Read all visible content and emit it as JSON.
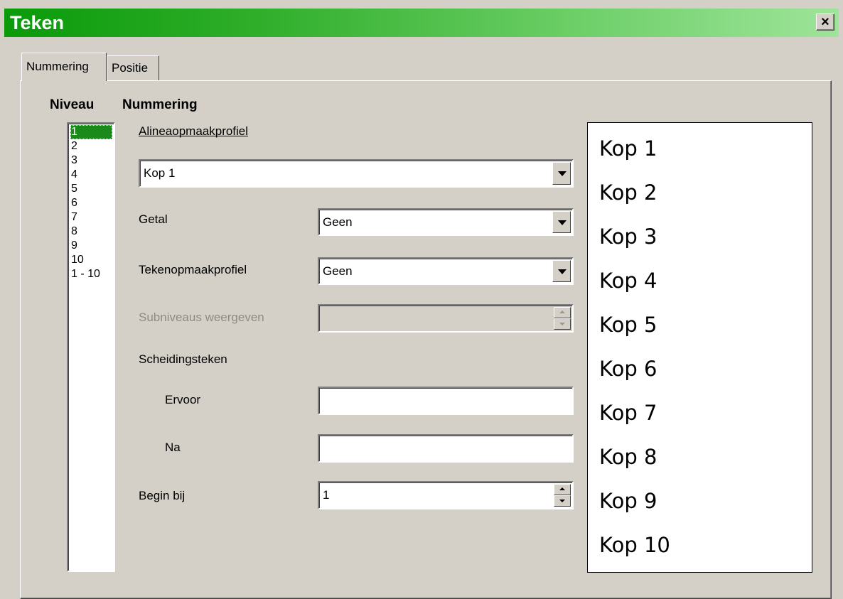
{
  "window": {
    "title": "Teken",
    "close_label": "×"
  },
  "tabs": [
    {
      "label": "Nummering",
      "active": true
    },
    {
      "label": "Positie",
      "active": false
    }
  ],
  "headings": {
    "level": "Niveau",
    "numbering": "Nummering"
  },
  "levels": {
    "items": [
      "1",
      "2",
      "3",
      "4",
      "5",
      "6",
      "7",
      "8",
      "9",
      "10",
      "1 - 10"
    ],
    "selected": "1"
  },
  "paragraph_style": {
    "label": "Alineaopmaakprofiel",
    "value": "Kop 1"
  },
  "number": {
    "label": "Getal",
    "value": "Geen"
  },
  "char_style": {
    "label": "Tekenopmaakprofiel",
    "value": "Geen"
  },
  "show_sublevels": {
    "label": "Subniveaus weergeven",
    "value": "",
    "enabled": false
  },
  "separator": {
    "label": "Scheidingsteken",
    "before_label": "Ervoor",
    "before_value": "",
    "after_label": "Na",
    "after_value": ""
  },
  "start_at": {
    "label": "Begin bij",
    "value": "1"
  },
  "preview": {
    "items": [
      "Kop 1",
      "Kop 2",
      "Kop 3",
      "Kop 4",
      "Kop 5",
      "Kop 6",
      "Kop 7",
      "Kop 8",
      "Kop 9",
      "Kop 10"
    ]
  },
  "colors": {
    "title_bar_start": "#0a9a0a",
    "title_bar_end": "#9ee49a",
    "selection": "#1a8a1a"
  }
}
